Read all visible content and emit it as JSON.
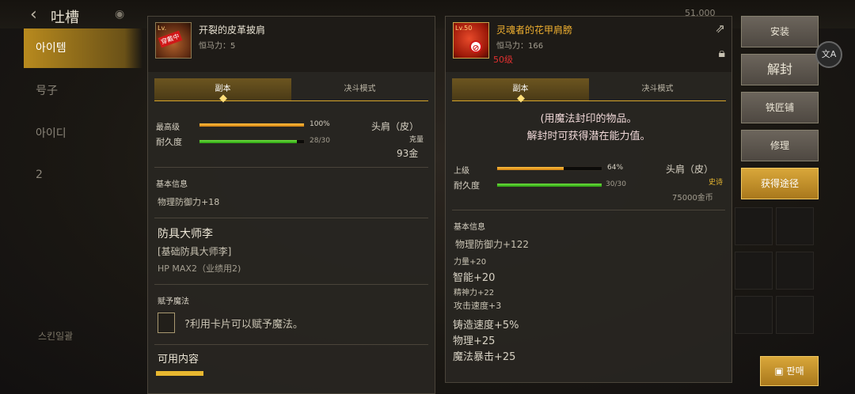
{
  "header": {
    "title": "吐槽",
    "status_value": "51,000"
  },
  "left_nav": {
    "items": [
      {
        "label": "아이템",
        "active": true
      },
      {
        "label": "号子",
        "active": false
      },
      {
        "label": "아이디",
        "active": false
      },
      {
        "label": "2",
        "active": false
      }
    ],
    "bottom_label": "스킨일괄"
  },
  "left_item": {
    "icon_level": "Lv.",
    "stamp": "穿戴中",
    "name": "开裂的皮革披肩",
    "constancy": "恒马力：5",
    "tabs": [
      "副本",
      "决斗模式"
    ],
    "grade_label": "最高级",
    "grade_percent": "100%",
    "grade_fill": 1.0,
    "slot_type": "头肩（皮）",
    "durability_label": "耐久度",
    "durability_text": "28/30",
    "durability_fill": 0.933,
    "weight_label": "克量",
    "price": "93金",
    "basic_info_label": "基本信息",
    "phys_def": "物理防御力+18",
    "npc_name": "防具大师李",
    "npc_sub": "[基础防具大师李]",
    "hp_line": "HP MAX2（业绩用2)",
    "enchant_label": "赋予魔法",
    "enchant_desc": "?利用卡片可以赋予魔法。",
    "available_label": "可用内容"
  },
  "right_item": {
    "icon_level": "Lv.50",
    "name": "灵魂者的花甲肩膀",
    "constancy": "恒马力：166",
    "level_text": "50级",
    "tabs": [
      "副本",
      "决斗模式"
    ],
    "notice_line1": "(用魔法封印的物品。",
    "notice_line2": "解封时可获得潜在能力值。",
    "grade_label": "上级",
    "grade_percent": "64%",
    "grade_fill": 0.64,
    "slot_type": "头肩（皮）",
    "durability_label": "耐久度",
    "durability_text": "30/30",
    "durability_fill": 1.0,
    "rarity": "史诗",
    "price": "75000金币",
    "basic_info_label": "基本信息",
    "stats": {
      "phys_def": "物理防御力+122",
      "strength": "力量+20",
      "intelligence": "智能+20",
      "spirit": "精神力+22",
      "attack_speed": "攻击速度+3",
      "forge_speed": "铸造速度+5%",
      "physical": "物理+25",
      "magic_crit": "魔法暴击+25"
    }
  },
  "right_buttons": {
    "install": "安装",
    "unseal": "解封",
    "blacksmith": "铁匠铺",
    "repair": "修理",
    "obtain": "获得途径",
    "sell": "판매"
  },
  "colors": {
    "accent_gold": "#d6a52b",
    "grade_bar": "#f0a020",
    "durability_bar": "#3cc020",
    "level_red": "#e03030"
  },
  "icons": [
    "back-arrow-icon",
    "eye-icon",
    "share-icon",
    "lock-icon",
    "no-entry-icon",
    "language-icon",
    "coin-icon"
  ]
}
